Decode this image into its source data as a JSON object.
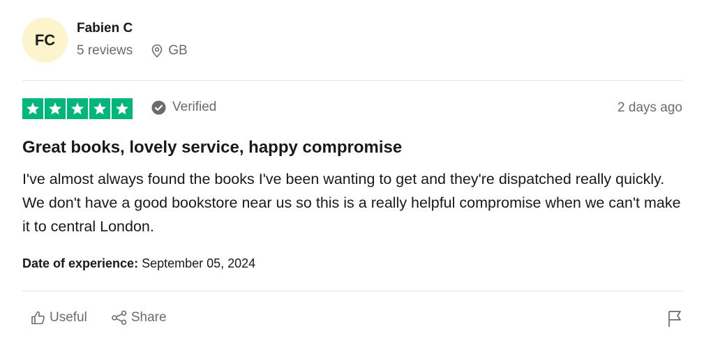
{
  "reviewer": {
    "initials": "FC",
    "name": "Fabien C",
    "reviews": "5 reviews",
    "location": "GB",
    "avatar_color": "#fcf4cc"
  },
  "rating": {
    "stars": 5,
    "max_stars": 5,
    "star_color": "#00b67a",
    "verified_label": "Verified",
    "posted": "2 days ago"
  },
  "review": {
    "title": "Great books, lovely service, happy compromise",
    "text": "I've almost always found the books I've been wanting to get and they're dispatched really quickly. We don't have a good bookstore near us so this is a really helpful compromise when we can't make it to central London.",
    "experience_label": "Date of experience:",
    "experience_date": "September 05, 2024"
  },
  "actions": {
    "useful_label": "Useful",
    "share_label": "Share",
    "icons": [
      "thumbs-up-icon",
      "share-icon",
      "flag-icon"
    ]
  }
}
